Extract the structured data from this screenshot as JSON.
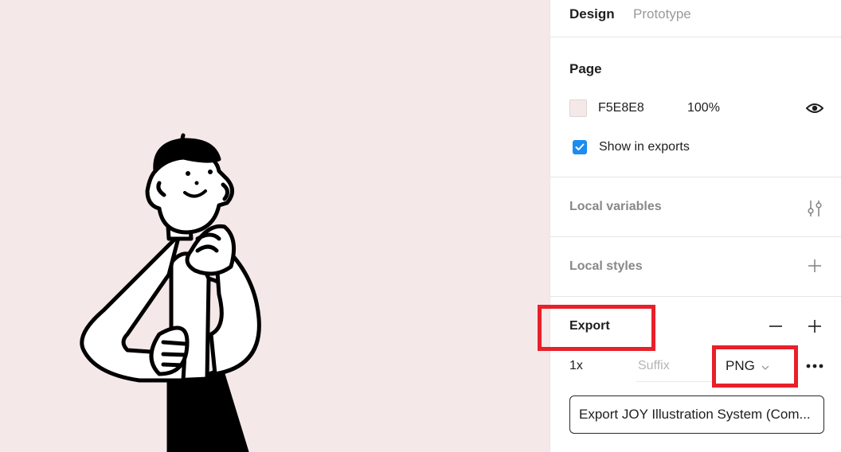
{
  "tabs": {
    "design": "Design",
    "prototype": "Prototype"
  },
  "page": {
    "title": "Page",
    "color_hex": "F5E8E8",
    "opacity": "100%",
    "show_in_exports_label": "Show in exports",
    "show_in_exports": true
  },
  "local_variables": {
    "label": "Local variables"
  },
  "local_styles": {
    "label": "Local styles"
  },
  "export": {
    "title": "Export",
    "scale": "1x",
    "suffix_placeholder": "Suffix",
    "format": "PNG",
    "button_label": "Export JOY Illustration System (Com..."
  },
  "colors": {
    "canvas_bg": "#F5E8E8",
    "accent_checkbox": "#1B8CF2",
    "highlight": "#E8202A"
  },
  "icons": {
    "visibility": "eye-icon",
    "variables": "sliders-icon",
    "add": "plus-icon",
    "remove": "minus-icon",
    "more": "more-dots-icon",
    "dropdown": "chevron-down-icon"
  }
}
